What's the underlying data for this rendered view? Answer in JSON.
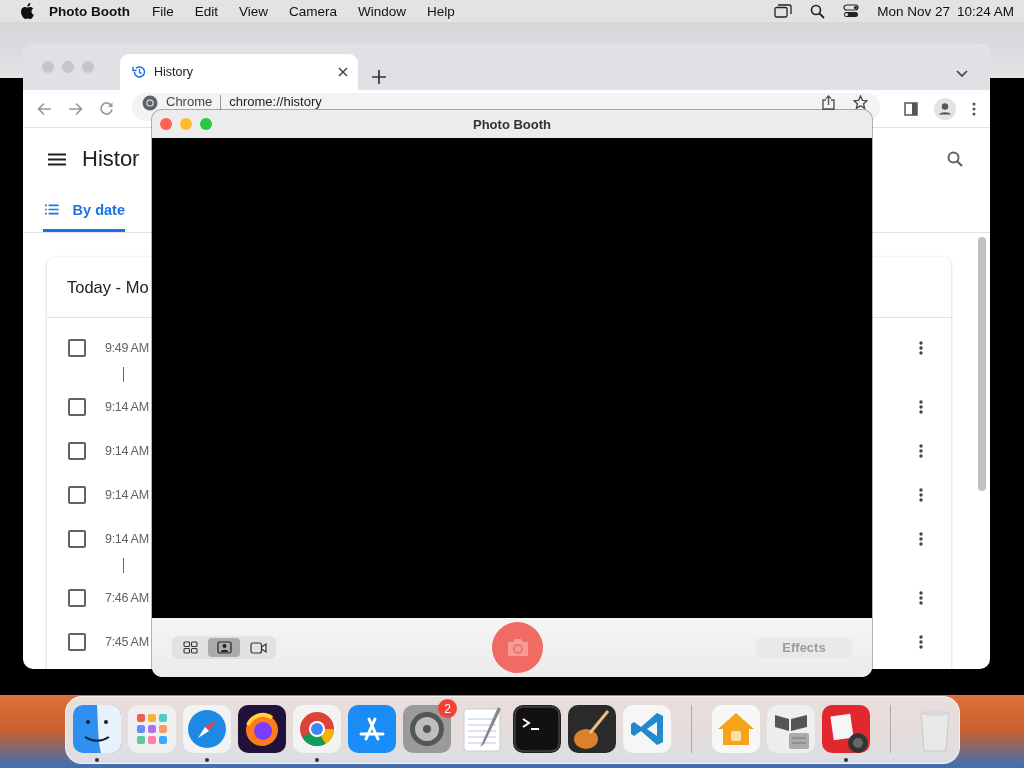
{
  "menu_bar": {
    "app_name": "Photo Booth",
    "menus": [
      "File",
      "Edit",
      "View",
      "Camera",
      "Window",
      "Help"
    ],
    "date": "Mon Nov 27",
    "time": "10:24 AM"
  },
  "browser": {
    "tabs": [
      {
        "label": "History",
        "selected": true
      }
    ],
    "omnibox": {
      "site_label": "Chrome",
      "url": "chrome://history"
    },
    "page": {
      "title": "Histor",
      "nav_tabs": [
        {
          "label": "By date",
          "selected": true
        }
      ],
      "section_title": "Today - Mo",
      "groups": [
        {
          "rows": [
            {
              "time": "9:49 AM",
              "checked": false
            }
          ]
        },
        {
          "rows": [
            {
              "time": "9:14 AM",
              "checked": false
            },
            {
              "time": "9:14 AM",
              "checked": false
            },
            {
              "time": "9:14 AM",
              "checked": false
            },
            {
              "time": "9:14 AM",
              "checked": false
            }
          ]
        },
        {
          "rows": [
            {
              "time": "7:46 AM",
              "checked": false
            },
            {
              "time": "7:45 AM",
              "checked": false
            }
          ]
        }
      ]
    }
  },
  "photo_booth": {
    "title": "Photo Booth",
    "view_modes": [
      {
        "kind": "grid",
        "selected": false
      },
      {
        "kind": "photo",
        "selected": true
      },
      {
        "kind": "video",
        "selected": false
      }
    ],
    "effects_button": {
      "label": "Effects",
      "disabled": true
    }
  },
  "dock": {
    "items": [
      {
        "kind": "finder",
        "running": true
      },
      {
        "kind": "launchpad",
        "running": false
      },
      {
        "kind": "safari",
        "running": true
      },
      {
        "kind": "firefox",
        "running": false
      },
      {
        "kind": "chrome",
        "running": true
      },
      {
        "kind": "appstore",
        "running": false
      },
      {
        "kind": "settings",
        "running": false,
        "badge": "2"
      },
      {
        "kind": "textedit",
        "running": false
      },
      {
        "kind": "terminal",
        "running": false
      },
      {
        "kind": "garageband",
        "running": false
      },
      {
        "kind": "vscode",
        "running": false
      },
      {
        "kind": "divider"
      },
      {
        "kind": "home",
        "running": false
      },
      {
        "kind": "bootcamp",
        "running": false
      },
      {
        "kind": "photobooth",
        "running": true
      },
      {
        "kind": "divider"
      },
      {
        "kind": "trash",
        "running": false
      }
    ]
  }
}
